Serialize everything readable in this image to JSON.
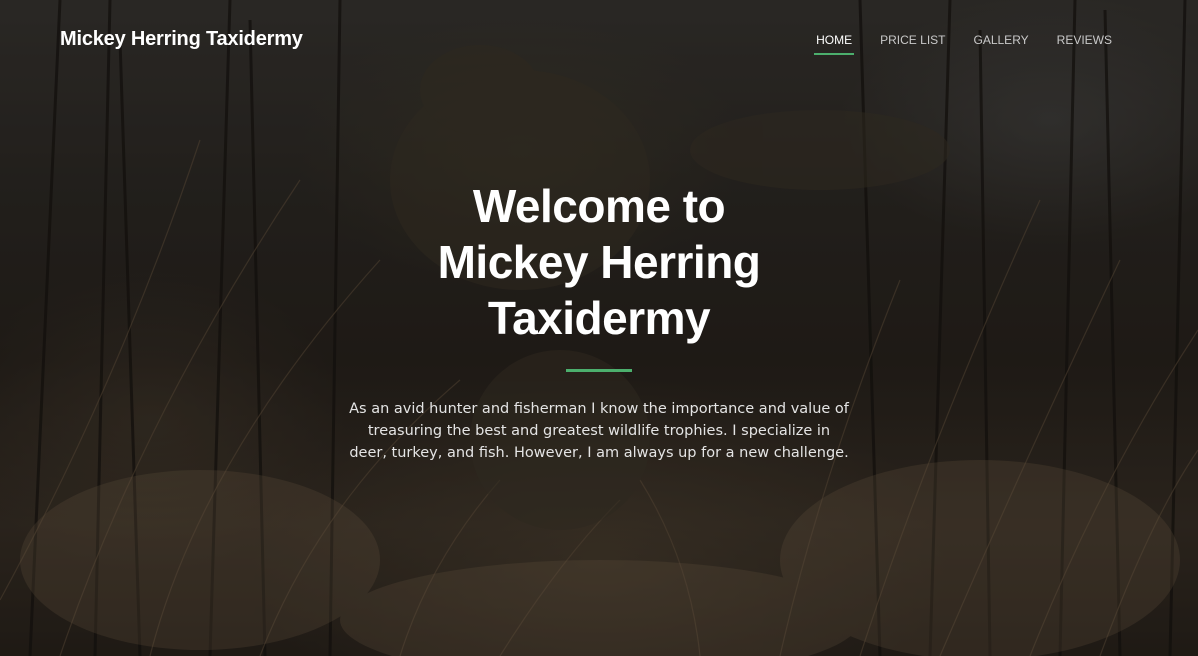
{
  "header": {
    "brand": "Mickey Herring Taxidermy",
    "nav": [
      {
        "label": "HOME",
        "active": true
      },
      {
        "label": "PRICE LIST",
        "active": false
      },
      {
        "label": "GALLERY",
        "active": false
      },
      {
        "label": "REVIEWS",
        "active": false
      }
    ]
  },
  "hero": {
    "title_line1": "Welcome to",
    "title_line2": "Mickey Herring",
    "title_line3": "Taxidermy",
    "description": "As an avid hunter and fisherman I know the importance and value of treasuring the best and greatest wildlife trophies. I specialize in deer, turkey, and fish. However, I am always up for a new challenge."
  },
  "colors": {
    "accent": "#4caf6d",
    "text": "#ffffff"
  }
}
